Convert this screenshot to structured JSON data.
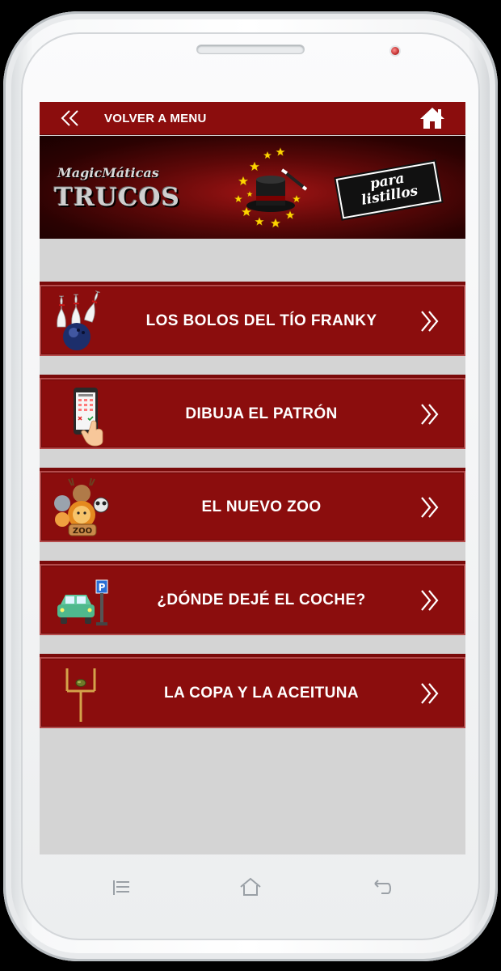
{
  "topbar": {
    "back_label": "VOLVER A MENU",
    "back_icon": "double-chevron-left-icon",
    "home_icon": "home-icon"
  },
  "banner": {
    "brand": "MagicMáticas",
    "title": "TRUCOS",
    "tag_line1": "para",
    "tag_line2": "listillos"
  },
  "menu": [
    {
      "label": "LOS BOLOS DEL TÍO FRANKY",
      "icon": "bowling-icon"
    },
    {
      "label": "DIBUJA EL PATRÓN",
      "icon": "phone-pattern-icon"
    },
    {
      "label": "EL NUEVO ZOO",
      "icon": "zoo-animals-icon"
    },
    {
      "label": "¿DÓNDE DEJÉ EL COCHE?",
      "icon": "car-parking-icon"
    },
    {
      "label": "LA COPA Y LA ACEITUNA",
      "icon": "goalpost-olive-icon"
    }
  ],
  "navbar": [
    "recent-apps-icon",
    "home-nav-icon",
    "back-nav-icon"
  ],
  "colors": {
    "accent": "#8b0d0d",
    "background": "#d4d4d4",
    "text": "#ffffff"
  }
}
